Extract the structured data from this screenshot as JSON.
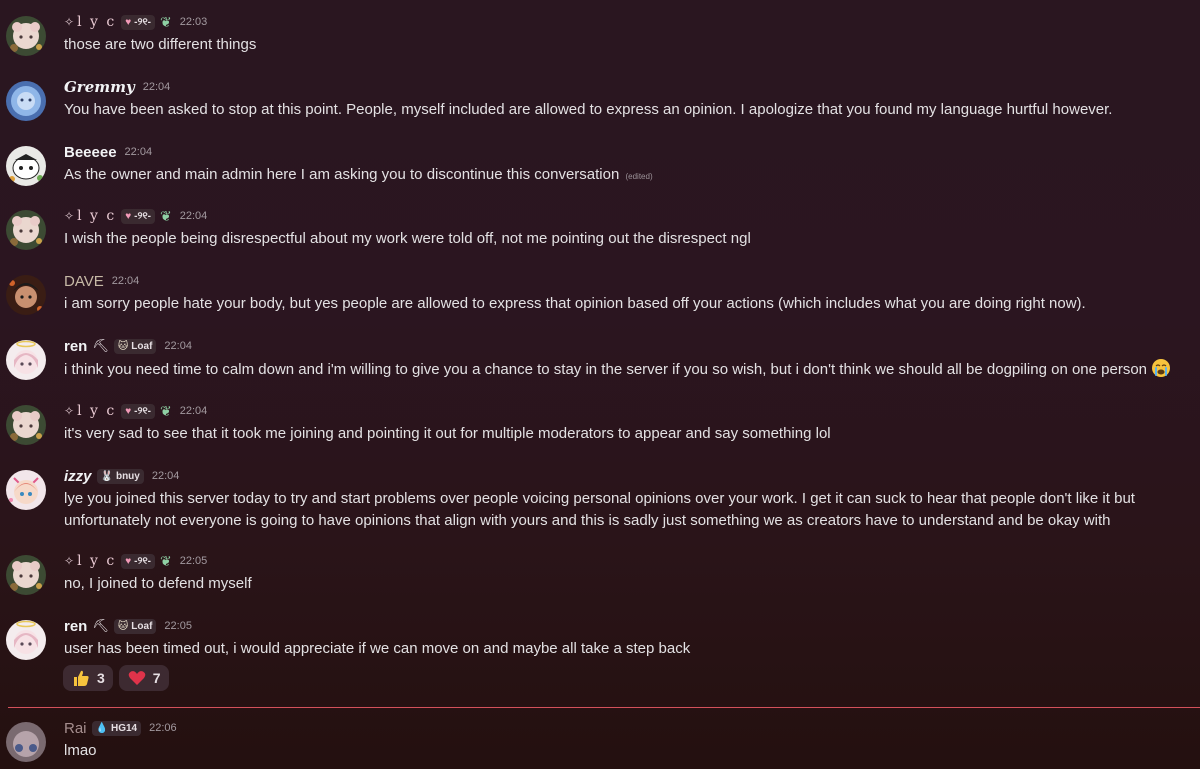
{
  "messages": [
    {
      "user": "l y c",
      "badge": "-୨୧-",
      "time": "22:03",
      "text": "those are two different things"
    },
    {
      "user": "Gremmy",
      "time": "22:04",
      "text": "You have been asked to stop at this point. People, myself included are allowed to express an opinion. I apologize that you found my language hurtful however."
    },
    {
      "user": "Beeeee",
      "time": "22:04",
      "text": "As the owner and main admin here I am asking you to discontinue this conversation",
      "edited": "(edited)"
    },
    {
      "user": "l y c",
      "badge": "-୨୧-",
      "time": "22:04",
      "text": "I wish the people being disrespectful about my work were told off, not me pointing out the disrespect ngl"
    },
    {
      "user": "DAVE",
      "time": "22:04",
      "text": "i am sorry people hate your body, but yes people are allowed to express that opinion based off your actions (which includes what you are doing right now)."
    },
    {
      "user": "ren",
      "badge": "Loaf",
      "time": "22:04",
      "text": "i think you need time to calm down and i'm willing to give you a chance to stay in the server if you so wish, but i don't think we should all be dogpiling on one person"
    },
    {
      "user": "l y c",
      "badge": "-୨୧-",
      "time": "22:04",
      "text": "it's very sad to see that it took me joining and pointing it out for multiple moderators to appear and say something lol"
    },
    {
      "user": "izzy",
      "badge": "bnuy",
      "time": "22:04",
      "text": "lye you joined this server today to try and start problems over people voicing personal opinions over your work. I get it can suck to hear that people don't like it but",
      "text2": "unfortunately not everyone is going to have opinions that align with yours and this is sadly just something we as creators have to understand and be okay with"
    },
    {
      "user": "l y c",
      "badge": "-୨୧-",
      "time": "22:05",
      "text": "no, I joined to defend myself"
    },
    {
      "user": "ren",
      "badge": "Loaf",
      "time": "22:05",
      "text": "user has been timed out, i would appreciate if we can move on and maybe all take a step back"
    },
    {
      "user": "Rai",
      "badge": "HG14",
      "time": "22:06",
      "text": "lmao"
    }
  ],
  "reactions": [
    {
      "icon": "thumbs-up-icon",
      "count": "3"
    },
    {
      "icon": "heart-icon",
      "count": "7"
    }
  ],
  "colors": {
    "divider": "#d4515b",
    "background": "#2a1620"
  }
}
